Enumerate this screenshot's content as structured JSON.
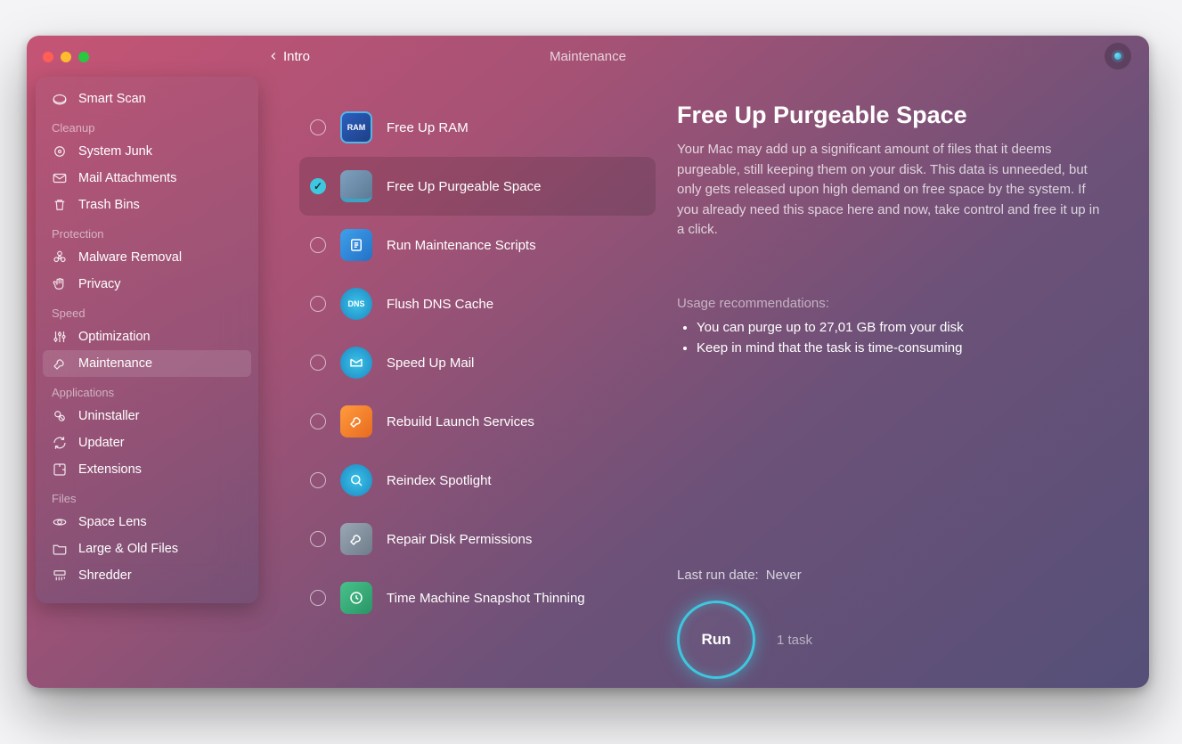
{
  "header": {
    "back_label": "Intro",
    "title": "Maintenance"
  },
  "sidebar": {
    "top_item": {
      "label": "Smart Scan",
      "icon": "lens-icon"
    },
    "sections": [
      {
        "label": "Cleanup",
        "items": [
          {
            "label": "System Junk",
            "icon": "gear-junk-icon"
          },
          {
            "label": "Mail Attachments",
            "icon": "envelope-icon"
          },
          {
            "label": "Trash Bins",
            "icon": "trash-icon"
          }
        ]
      },
      {
        "label": "Protection",
        "items": [
          {
            "label": "Malware Removal",
            "icon": "biohazard-icon"
          },
          {
            "label": "Privacy",
            "icon": "hand-icon"
          }
        ]
      },
      {
        "label": "Speed",
        "items": [
          {
            "label": "Optimization",
            "icon": "sliders-icon"
          },
          {
            "label": "Maintenance",
            "icon": "wrench-icon",
            "active": true
          }
        ]
      },
      {
        "label": "Applications",
        "items": [
          {
            "label": "Uninstaller",
            "icon": "uninstall-icon"
          },
          {
            "label": "Updater",
            "icon": "update-icon"
          },
          {
            "label": "Extensions",
            "icon": "puzzle-icon"
          }
        ]
      },
      {
        "label": "Files",
        "items": [
          {
            "label": "Space Lens",
            "icon": "orbit-icon"
          },
          {
            "label": "Large & Old Files",
            "icon": "folder-icon"
          },
          {
            "label": "Shredder",
            "icon": "shredder-icon"
          }
        ]
      }
    ]
  },
  "tasks": [
    {
      "label": "Free Up RAM",
      "checked": false,
      "icon_text": "RAM",
      "icon_class": "ic-ram"
    },
    {
      "label": "Free Up Purgeable Space",
      "checked": true,
      "selected": true,
      "icon_class": "ic-disk"
    },
    {
      "label": "Run Maintenance Scripts",
      "checked": false,
      "icon_class": "ic-script",
      "svg": "list"
    },
    {
      "label": "Flush DNS Cache",
      "checked": false,
      "icon_text": "DNS",
      "icon_class": "ic-dns"
    },
    {
      "label": "Speed Up Mail",
      "checked": false,
      "icon_class": "ic-mail",
      "svg": "mail"
    },
    {
      "label": "Rebuild Launch Services",
      "checked": false,
      "icon_class": "ic-launch",
      "svg": "wrench"
    },
    {
      "label": "Reindex Spotlight",
      "checked": false,
      "icon_class": "ic-search",
      "svg": "search"
    },
    {
      "label": "Repair Disk Permissions",
      "checked": false,
      "icon_class": "ic-repair",
      "svg": "wrench"
    },
    {
      "label": "Time Machine Snapshot Thinning",
      "checked": false,
      "icon_class": "ic-tm",
      "svg": "clock"
    }
  ],
  "detail": {
    "title": "Free Up Purgeable Space",
    "description": "Your Mac may add up a significant amount of files that it deems purgeable, still keeping them on your disk. This data is unneeded, but only gets released upon high demand on free space by the system. If you already need this space here and now, take control and free it up in a click.",
    "recommendations_label": "Usage recommendations:",
    "recommendations": [
      "You can purge up to 27,01 GB from your disk",
      "Keep in mind that the task is time-consuming"
    ],
    "last_run_label": "Last run date:",
    "last_run_value": "Never",
    "run_label": "Run",
    "task_count_label": "1 task"
  }
}
